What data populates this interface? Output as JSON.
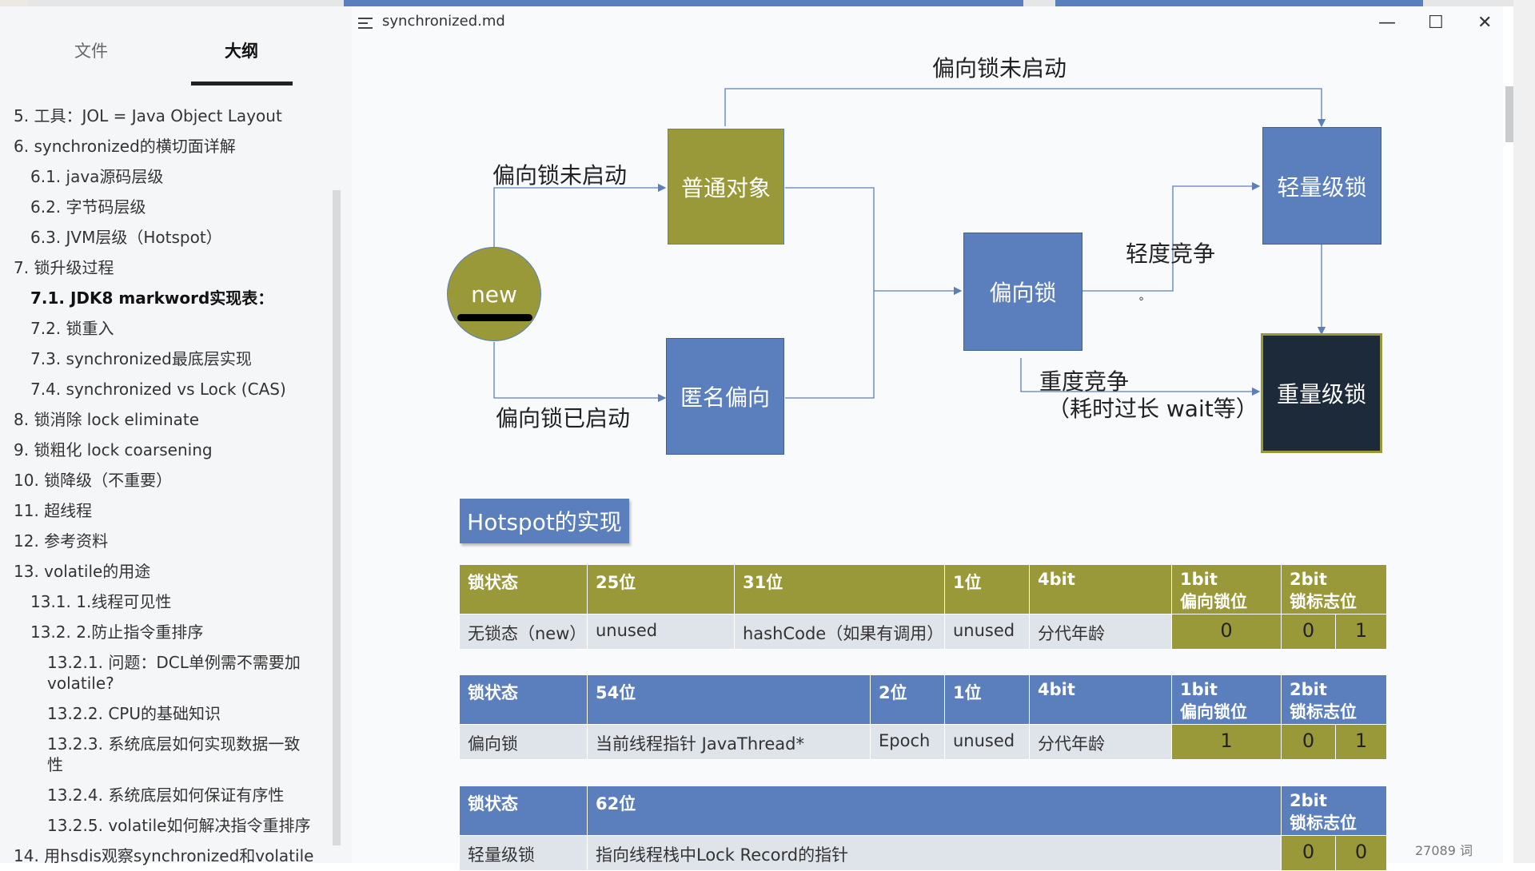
{
  "window": {
    "doc_title": "synchronized.md",
    "minimize_icon": "—",
    "maximize_icon": "☐",
    "close_icon": "✕"
  },
  "sidebar": {
    "tabs": [
      {
        "label": "文件"
      },
      {
        "label": "大纲"
      }
    ],
    "outline": [
      {
        "label": "5. 工具：JOL = Java Object Layout"
      },
      {
        "label": "6. synchronized的横切面详解"
      },
      {
        "label": "6.1. java源码层级"
      },
      {
        "label": "6.2. 字节码层级"
      },
      {
        "label": "6.3. JVM层级（Hotspot）"
      },
      {
        "label": "7. 锁升级过程"
      },
      {
        "label": "7.1. JDK8 markword实现表："
      },
      {
        "label": "7.2. 锁重入"
      },
      {
        "label": "7.3. synchronized最底层实现"
      },
      {
        "label": "7.4. synchronized vs Lock (CAS)"
      },
      {
        "label": "8. 锁消除 lock eliminate"
      },
      {
        "label": "9. 锁粗化 lock coarsening"
      },
      {
        "label": "10. 锁降级（不重要）"
      },
      {
        "label": "11. 超线程"
      },
      {
        "label": "12. 参考资料"
      },
      {
        "label": "13. volatile的用途"
      },
      {
        "label": "13.1. 1.线程可见性"
      },
      {
        "label": "13.2. 2.防止指令重排序"
      },
      {
        "label": "13.2.1. 问题：DCL单例需不需要加"
      },
      {
        "label": "volatile?"
      },
      {
        "label": "13.2.2. CPU的基础知识"
      },
      {
        "label": "13.2.3. 系统底层如何实现数据一致"
      },
      {
        "label": "性"
      },
      {
        "label": "13.2.4. 系统底层如何保证有序性"
      },
      {
        "label": "13.2.5. volatile如何解决指令重排序"
      },
      {
        "label": "14. 用hsdis观察synchronized和volatile"
      }
    ],
    "footer_left": "‹",
    "footer_right": "</>"
  },
  "diagram": {
    "top_label": "偏向锁未启动",
    "upper_left_label": "偏向锁未启动",
    "lower_left_label": "偏向锁已启动",
    "light_contention": "轻度竞争",
    "heavy_contention_1": "重度竞争",
    "heavy_contention_2": "（耗时过长 wait等）",
    "new": "new",
    "normal_object": "普通对象",
    "anonymous_biased": "匿名偏向",
    "biased_lock": "偏向锁",
    "lightweight_lock": "轻量级锁",
    "heavyweight_lock": "重量级锁",
    "dot": "°"
  },
  "hotspot_title": "Hotspot的实现",
  "tables": {
    "t1": {
      "headers": [
        "锁状态",
        "25位",
        "31位",
        "1位",
        "4bit",
        "1bit",
        "偏向锁位",
        "2bit",
        "锁标志位"
      ],
      "row": [
        "无锁态（new）",
        "unused",
        "hashCode（如果有调用）",
        "unused",
        "分代年龄",
        "0",
        "0",
        "1"
      ]
    },
    "t2": {
      "headers": [
        "锁状态",
        "54位",
        "2位",
        "1位",
        "4bit",
        "1bit",
        "偏向锁位",
        "2bit",
        "锁标志位"
      ],
      "row": [
        "偏向锁",
        "当前线程指针 JavaThread*",
        "Epoch",
        "unused",
        "分代年龄",
        "1",
        "0",
        "1"
      ]
    },
    "t3": {
      "headers": [
        "锁状态",
        "62位",
        "2bit",
        "锁标志位"
      ],
      "row": [
        "轻量级锁",
        "指向线程栈中Lock Record的指针",
        "0",
        "0"
      ]
    }
  },
  "status": {
    "word_count": "27089 词"
  },
  "colors": {
    "olive": "#9a993a",
    "blue": "#5b7fbd",
    "navy": "#1c2a3a"
  }
}
